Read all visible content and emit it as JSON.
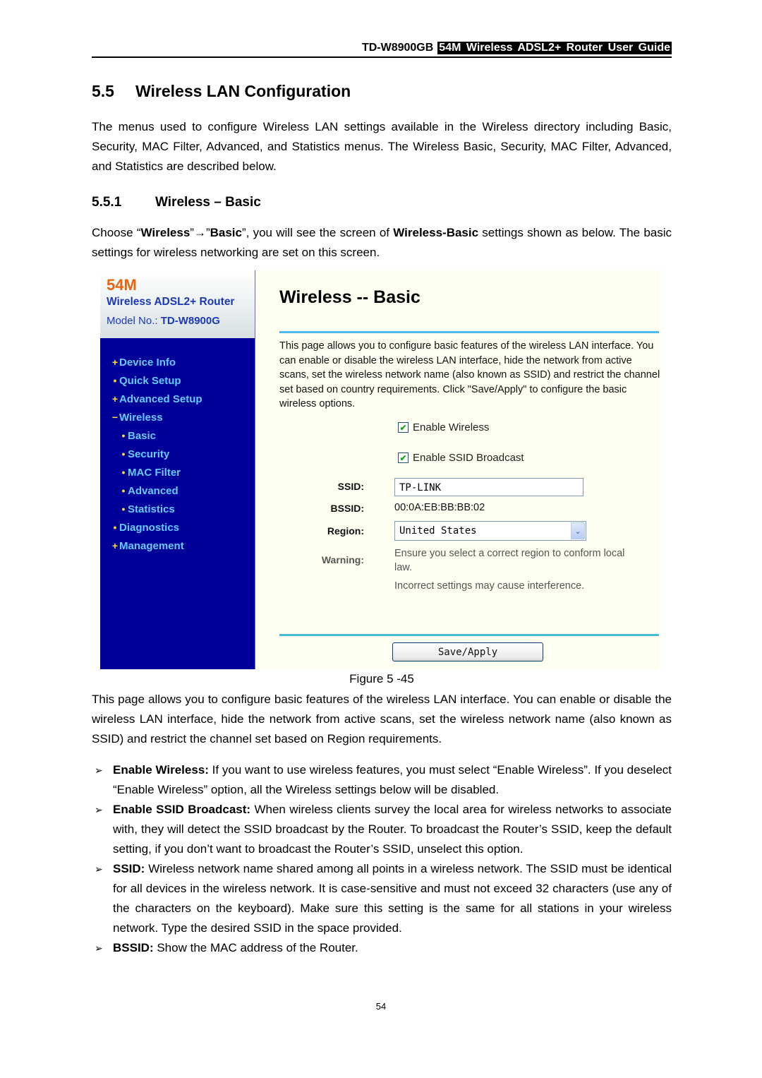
{
  "header": {
    "model": "TD-W8900GB",
    "guide_title": "54M Wireless ADSL2+ Router User Guide"
  },
  "section": {
    "number": "5.5",
    "title": "Wireless LAN Configuration",
    "intro": "The menus used to configure Wireless LAN settings available in the Wireless directory including Basic, Security, MAC Filter, Advanced, and Statistics menus. The Wireless Basic, Security, MAC Filter, Advanced, and Statistics are described below."
  },
  "subsection": {
    "number": "5.5.1",
    "title": "Wireless – Basic",
    "choose_prefix": "Choose “",
    "choose_menu1": "Wireless",
    "choose_arrow": "”→”",
    "choose_menu2": "Basic",
    "choose_mid": "”, you will see the screen of ",
    "choose_screen": "Wireless-Basic",
    "choose_suffix": " settings shown as below. The basic settings for wireless networking are set on this screen."
  },
  "screenshot": {
    "brand": {
      "speed": "54M",
      "product": "Wireless ADSL2+ Router",
      "model_label": "Model No.:",
      "model_value": "TD-W8900G"
    },
    "nav": [
      {
        "marker": "+",
        "label": "Device Info",
        "level": 0
      },
      {
        "marker": "•",
        "label": "Quick Setup",
        "level": 0
      },
      {
        "marker": "+",
        "label": "Advanced Setup",
        "level": 0
      },
      {
        "marker": "−",
        "label": "Wireless",
        "level": 0
      },
      {
        "marker": "•",
        "label": "Basic",
        "level": 1
      },
      {
        "marker": "•",
        "label": "Security",
        "level": 1
      },
      {
        "marker": "•",
        "label": "MAC Filter",
        "level": 1
      },
      {
        "marker": "•",
        "label": "Advanced",
        "level": 1
      },
      {
        "marker": "•",
        "label": "Statistics",
        "level": 1
      },
      {
        "marker": "•",
        "label": "Diagnostics",
        "level": 0
      },
      {
        "marker": "+",
        "label": "Management",
        "level": 0
      }
    ],
    "title": "Wireless -- Basic",
    "description": "This page allows you to configure basic features of the wireless LAN interface. You can enable or disable the wireless LAN interface, hide the network from active scans, set the wireless network name (also known as SSID) and restrict the channel set based on country requirements. Click \"Save/Apply\" to configure the basic wireless options.",
    "enable_wireless": {
      "label": "Enable Wireless",
      "checked": true
    },
    "enable_ssid_broadcast": {
      "label": "Enable SSID Broadcast",
      "checked": true
    },
    "ssid": {
      "label": "SSID:",
      "value": "TP-LINK"
    },
    "bssid": {
      "label": "BSSID:",
      "value": "00:0A:EB:BB:BB:02"
    },
    "region": {
      "label": "Region:",
      "value": "United States"
    },
    "warning": {
      "label": "Warning:",
      "line1": "Ensure you select a correct region to conform local law.",
      "line2": "Incorrect settings may cause interference."
    },
    "save_label": "Save/Apply",
    "check_glyph": "✔",
    "dropdown_glyph": "⌄"
  },
  "figure_caption": "Figure 5 -45",
  "after_text": "This page allows you to configure basic features of the wireless LAN interface. You can enable or disable the wireless LAN interface, hide the network from active scans, set the wireless network name (also known as SSID) and restrict the channel set based on Region requirements.",
  "bullets": [
    {
      "term": "Enable Wireless:",
      "text": " If you want to use wireless features, you must select “Enable Wireless”. If you deselect “Enable Wireless” option, all the Wireless settings below will be disabled."
    },
    {
      "term": "Enable SSID Broadcast:",
      "text": " When wireless clients survey the local area for wireless networks to associate with, they will detect the SSID broadcast by the Router. To broadcast the Router’s SSID, keep the default setting, if you don’t want to broadcast the Router’s SSID, unselect this option."
    },
    {
      "term": "SSID:",
      "text": " Wireless network name shared among all points in a wireless network. The SSID must be identical for all devices in the wireless network. It is case-sensitive and must not exceed 32 characters (use any of the characters on the keyboard). Make sure this setting is the same for all stations in your wireless network. Type the desired SSID in the space provided."
    },
    {
      "term": "BSSID:",
      "text": " Show the MAC address of the Router."
    }
  ],
  "bullet_glyph": "➢",
  "page_number": "54"
}
